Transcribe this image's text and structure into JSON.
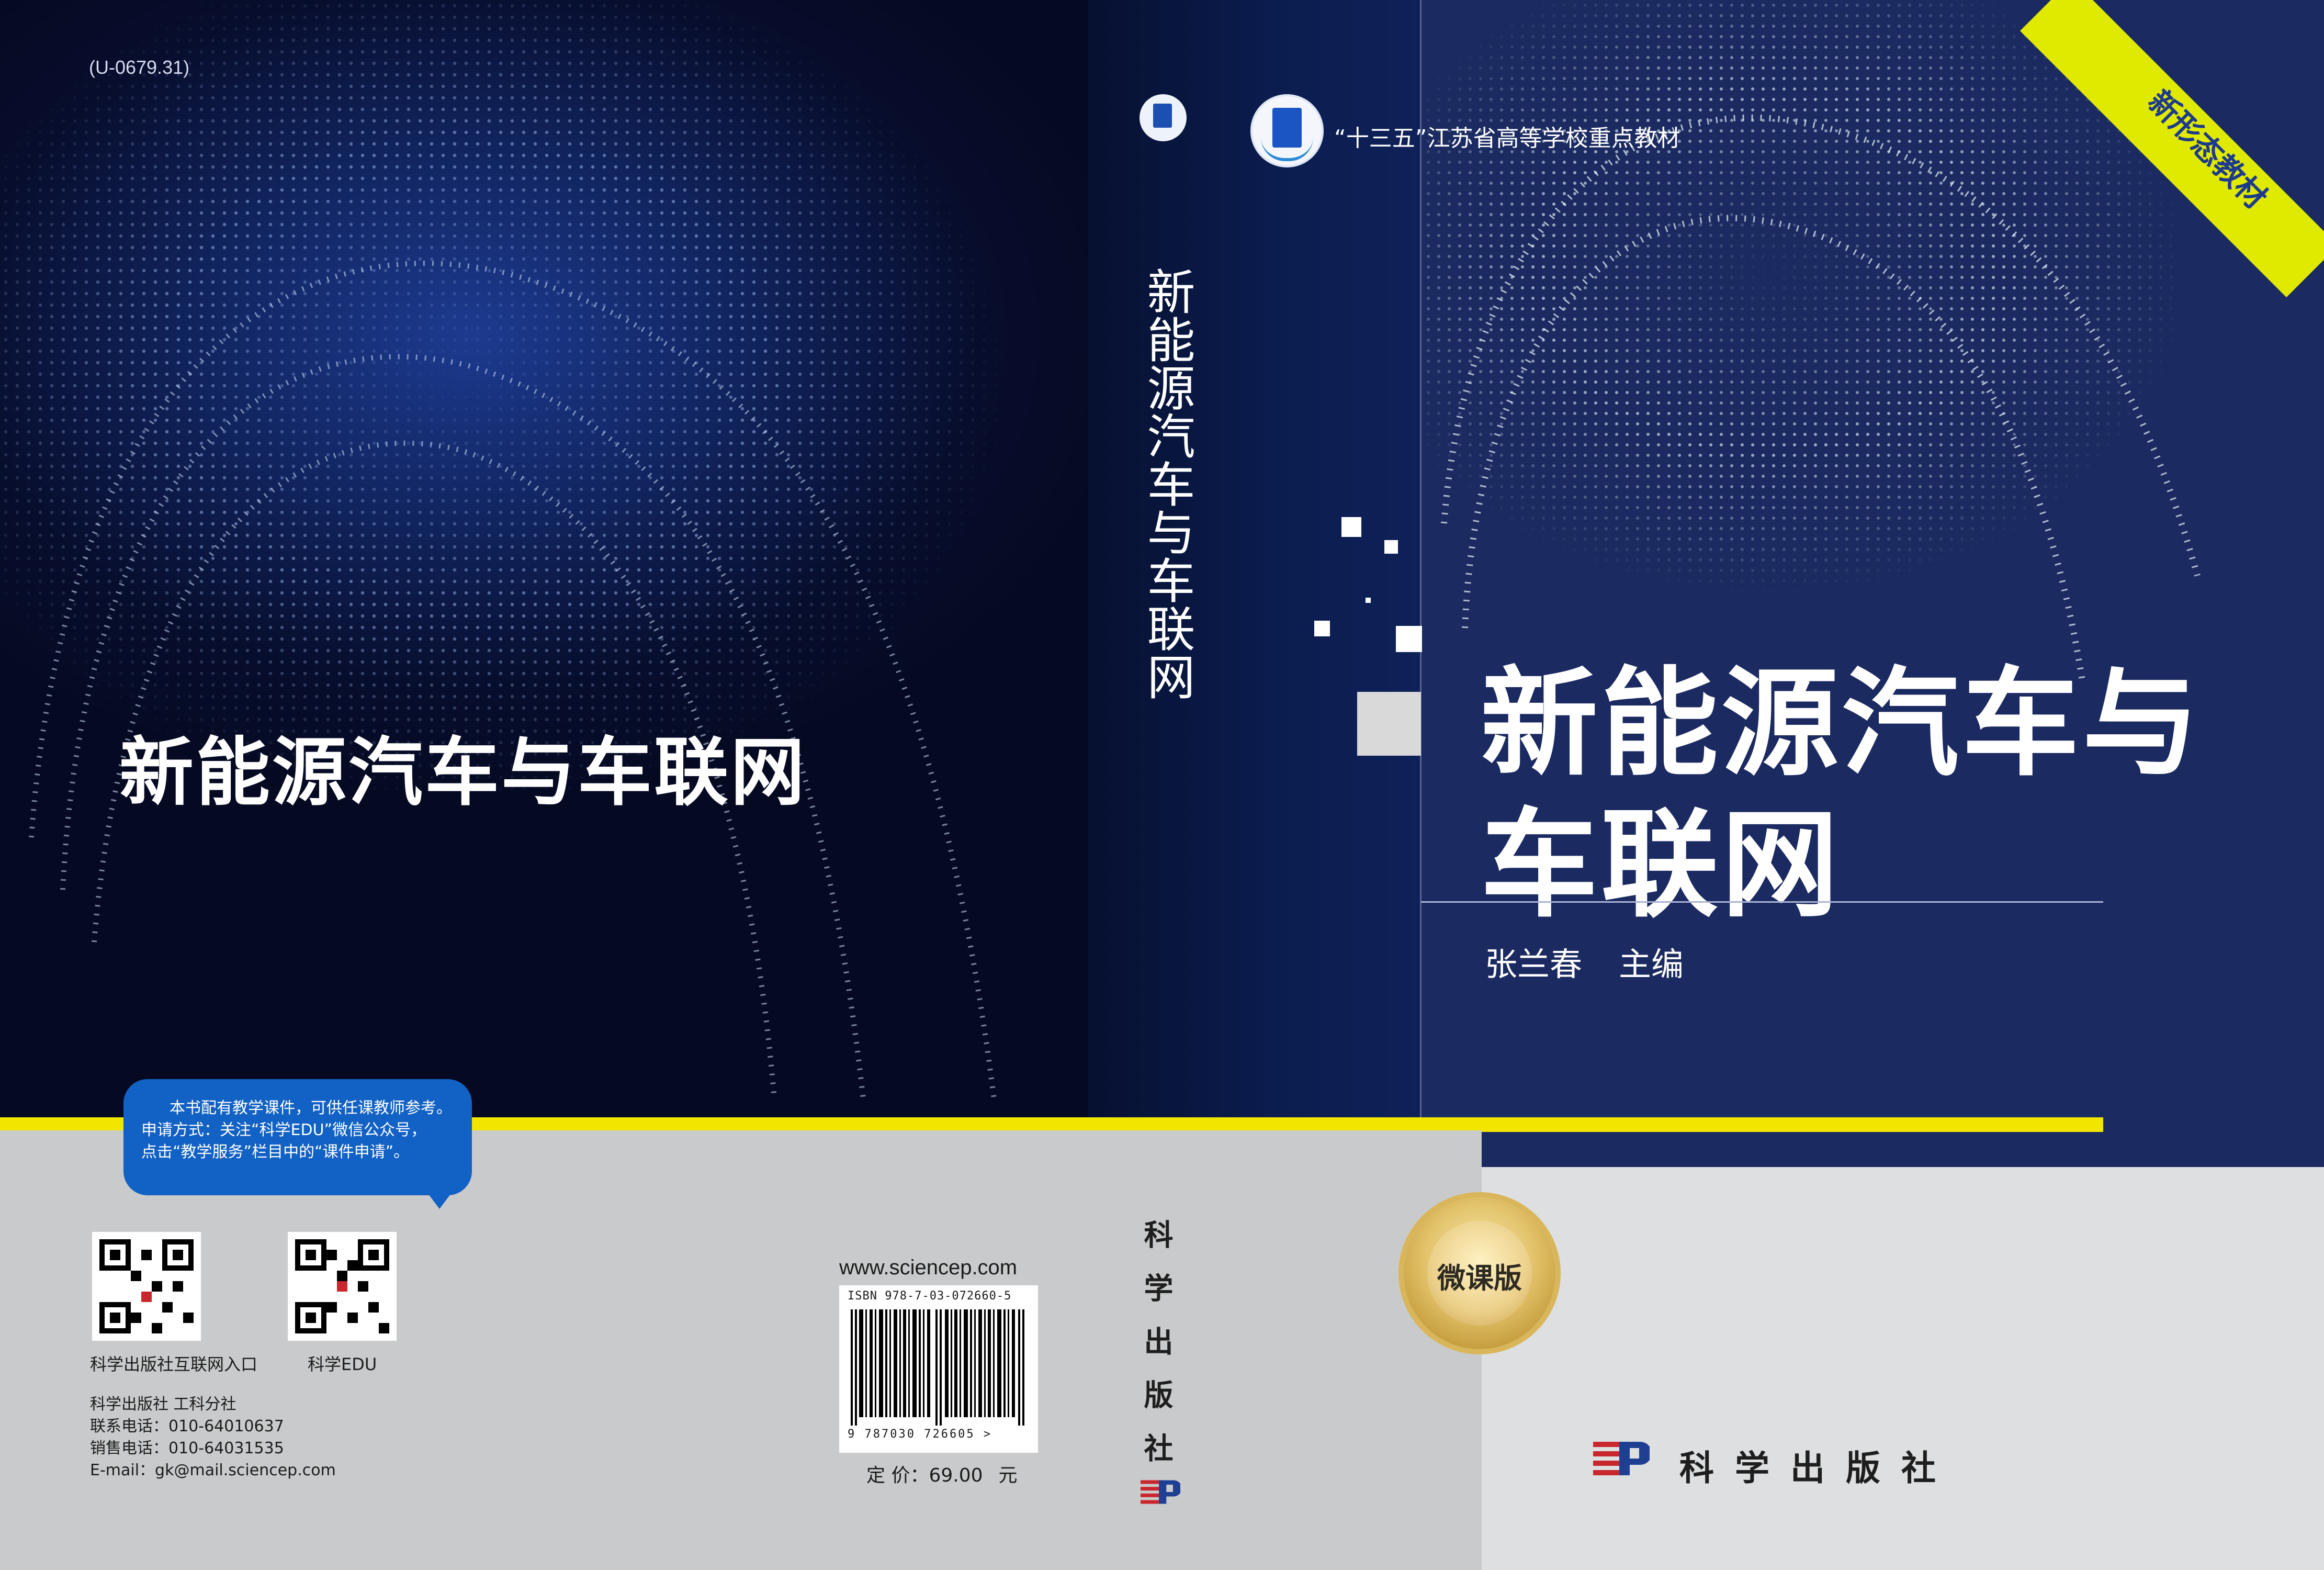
{
  "back_cover": {
    "catalog_id": "(U-0679.31)",
    "title": "新能源汽车与车联网",
    "notice": {
      "line1": "本书配有教学课件，可供任课教师参考。",
      "line2": "申请方式：关注“科学EDU”微信公众号，",
      "line3": "点击“教学服务”栏目中的“课件申请”。"
    },
    "qr_codes": [
      {
        "label": "科学出版社互联网入口",
        "icon": "qr-code-icon"
      },
      {
        "label": "科学EDU",
        "icon": "qr-code-icon"
      }
    ],
    "contact": {
      "publisher": "科学出版社  工科分社",
      "phone": "联系电话：010-64010637",
      "sales": "销售电话：010-64031535",
      "email": "E-mail：gk@mail.sciencep.com"
    },
    "website": "www.sciencep.com",
    "isbn_text": "ISBN 978-7-03-072660-5",
    "barcode_digits": "9 787030 726605 >",
    "price_label": "定 价：69.00",
    "price_unit": "元"
  },
  "spine": {
    "title": "新能源汽车与车联网",
    "publisher": "科学出版社",
    "logo_icon": "textbook-badge-icon"
  },
  "front_cover": {
    "series": "“十三五”江苏省高等学校重点教材",
    "ribbon": "新形态教材",
    "title_line1": "新能源汽车与",
    "title_line2": "车联网",
    "author": "张兰春",
    "author_role": "主编",
    "seal": "微课版",
    "publisher": "科学出版社",
    "logo_icon": "science-press-logo-icon"
  },
  "colors": {
    "navy": "#1b2a60",
    "accent_yellow": "#f2e500",
    "ribbon_yellow": "#e0ea00",
    "bubble_blue": "#1261c4",
    "grey": "#c9cacb"
  }
}
